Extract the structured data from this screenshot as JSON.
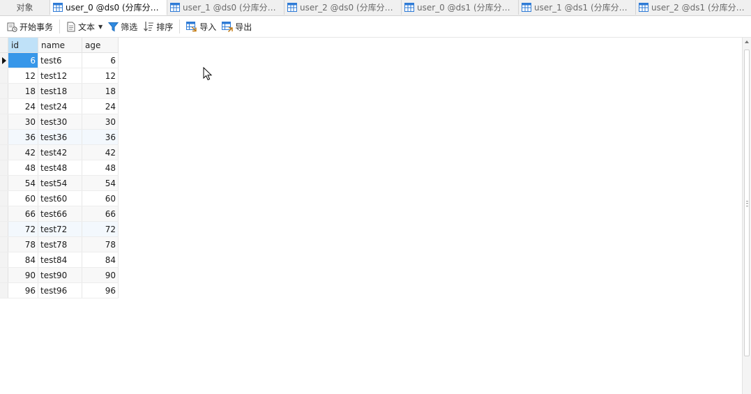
{
  "tabs": [
    {
      "label": "对象",
      "kind": "objects"
    },
    {
      "label": "user_0 @ds0 (分库分表...",
      "kind": "table",
      "active": true
    },
    {
      "label": "user_1 @ds0 (分库分表...",
      "kind": "table"
    },
    {
      "label": "user_2 @ds0 (分库分表...",
      "kind": "table"
    },
    {
      "label": "user_0 @ds1 (分库分表...",
      "kind": "table"
    },
    {
      "label": "user_1 @ds1 (分库分表...",
      "kind": "table"
    },
    {
      "label": "user_2 @ds1 (分库分表...",
      "kind": "table"
    }
  ],
  "toolbar": {
    "begin_transaction": "开始事务",
    "text": "文本",
    "filter": "筛选",
    "sort": "排序",
    "import": "导入",
    "export": "导出"
  },
  "grid": {
    "columns": [
      "id",
      "name",
      "age"
    ],
    "rows": [
      [
        "6",
        "test6",
        "6"
      ],
      [
        "12",
        "test12",
        "12"
      ],
      [
        "18",
        "test18",
        "18"
      ],
      [
        "24",
        "test24",
        "24"
      ],
      [
        "30",
        "test30",
        "30"
      ],
      [
        "36",
        "test36",
        "36"
      ],
      [
        "42",
        "test42",
        "42"
      ],
      [
        "48",
        "test48",
        "48"
      ],
      [
        "54",
        "test54",
        "54"
      ],
      [
        "60",
        "test60",
        "60"
      ],
      [
        "66",
        "test66",
        "66"
      ],
      [
        "72",
        "test72",
        "72"
      ],
      [
        "78",
        "test78",
        "78"
      ],
      [
        "84",
        "test84",
        "84"
      ],
      [
        "90",
        "test90",
        "90"
      ],
      [
        "96",
        "test96",
        "96"
      ]
    ]
  },
  "colors": {
    "selection": "#3797e9",
    "header_selected": "#bfe1f8",
    "icon_blue": "#2f7bd6"
  }
}
